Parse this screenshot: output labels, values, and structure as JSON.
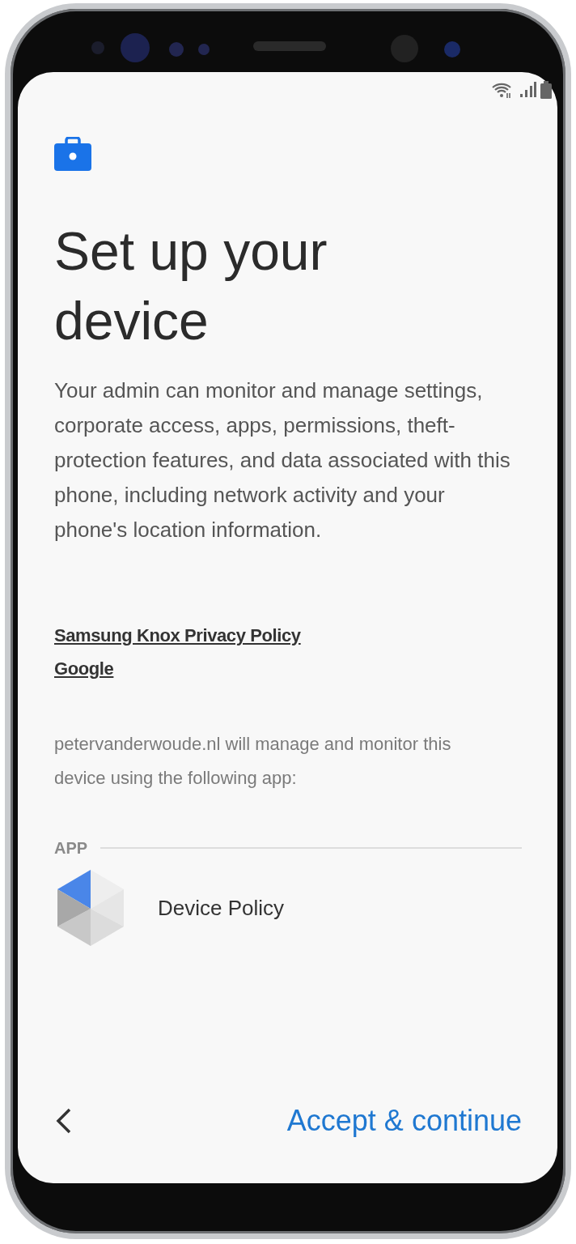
{
  "header": {
    "title": "Set up your device",
    "description": "Your admin can monitor and manage settings, corporate access, apps, permissions, theft-protection features, and data associated with this phone, including network activity and your phone's location information."
  },
  "links": [
    "Samsung Knox Privacy Policy",
    "Google"
  ],
  "management_notice": "petervanderwoude.nl will manage and monitor this device using the following app:",
  "app_section": {
    "heading": "APP",
    "apps": [
      {
        "name": "Device Policy"
      }
    ]
  },
  "footer": {
    "primary_button": "Accept & continue"
  }
}
